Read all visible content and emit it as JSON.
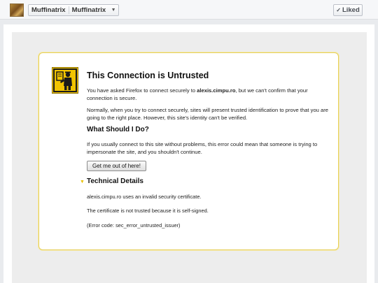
{
  "topbar": {
    "page_name_1": "Muffinatrix",
    "page_name_2": "Muffinatrix",
    "liked_label": "Liked"
  },
  "error": {
    "title": "This Connection is Untrusted",
    "intro_before": "You have asked Firefox to connect securely to ",
    "intro_host": "alexis.cimpu.ro",
    "intro_after": ", but we can't confirm that your connection is secure.",
    "normally": "Normally, when you try to connect securely, sites will present trusted identification to prove that you are going to the right place. However, this site's identity can't be verified.",
    "what_heading": "What Should I Do?",
    "what_text": "If you usually connect to this site without problems, this error could mean that someone is trying to impersonate the site, and you shouldn't continue.",
    "getout_label": "Get me out of here!",
    "tech_heading": "Technical Details",
    "tech_line1": "alexis.cimpu.ro uses an invalid security certificate.",
    "tech_line2": "The certificate is not trusted because it is self-signed.",
    "tech_line3": "(Error code: sec_error_untrusted_issuer)"
  },
  "colors": {
    "accent_yellow": "#e5cf5a",
    "icon_yellow": "#f2c400"
  },
  "icons": {
    "avatar": "page-avatar",
    "select_caret": "chevron-down-icon",
    "liked_check": "checkmark-icon",
    "cert": "untrusted-certificate-icon",
    "tech_toggle": "expand-triangle-icon"
  }
}
